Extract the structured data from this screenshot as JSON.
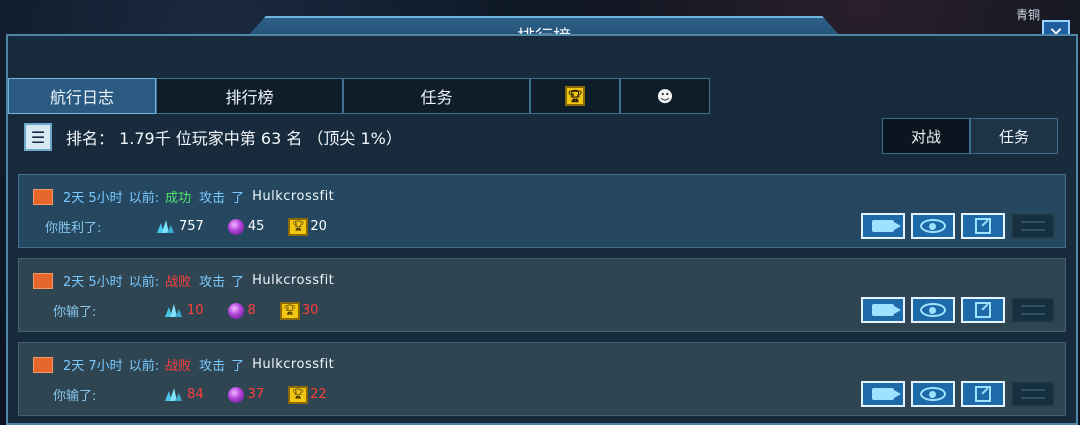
{
  "hud": {
    "rank_label": "青铜"
  },
  "window": {
    "title": "排行榜",
    "close_symbol": "✕"
  },
  "tabs": [
    {
      "label": "航行日志",
      "active": true
    },
    {
      "label": "排行榜",
      "active": false
    },
    {
      "label": "任务",
      "active": false
    },
    {
      "icon": "trophy-icon",
      "active": false
    },
    {
      "icon": "robot-icon",
      "active": false
    }
  ],
  "rank": {
    "text": "排名： 1.79千 位玩家中第 63 名 （顶尖 1%）"
  },
  "mode_toggle": {
    "battle_label": "对战",
    "mission_label": "任务"
  },
  "entries": [
    {
      "time": "2天 5小时",
      "ago": "以前:",
      "result": "成功",
      "attack": "攻击",
      "le": "了",
      "opponent": "Hulkcrossfit",
      "outcome_label": "你胜利了:",
      "minerals": "757",
      "gas": "45",
      "trophies": "20",
      "state": "success"
    },
    {
      "time": "2天 5小时",
      "ago": "以前:",
      "result": "战败",
      "attack": "攻击",
      "le": "了",
      "opponent": "Hulkcrossfit",
      "outcome_label": "你输了:",
      "minerals": "10",
      "gas": "8",
      "trophies": "30",
      "state": "fail"
    },
    {
      "time": "2天 7小时",
      "ago": "以前:",
      "result": "战败",
      "attack": "攻击",
      "le": "了",
      "opponent": "Hulkcrossfit",
      "outcome_label": "你输了:",
      "minerals": "84",
      "gas": "37",
      "trophies": "22",
      "state": "fail"
    }
  ],
  "colors": {
    "success": "#55e36e",
    "fail": "#ff3c3c",
    "accent": "#79c8ff"
  }
}
